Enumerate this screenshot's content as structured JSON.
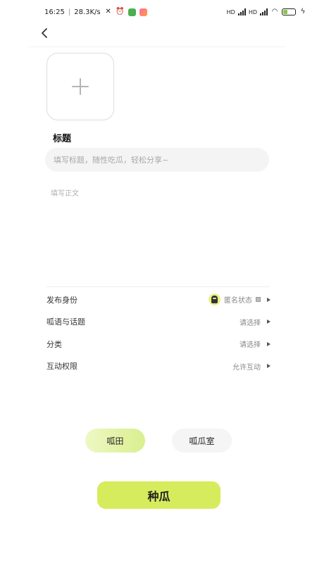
{
  "status_bar": {
    "time": "16:25",
    "separator": "|",
    "speed": "28.3K/s",
    "network_label_1": "HD",
    "network_label_2": "HD",
    "battery_level": 0.35
  },
  "header": {
    "back_icon": "chevron-left-icon"
  },
  "composer": {
    "add_image_icon": "plus-icon",
    "title_label": "标题",
    "title_placeholder": "填写标题，随性吃瓜，轻松分享~",
    "title_value": "",
    "body_placeholder": "填写正文",
    "body_value": ""
  },
  "settings": [
    {
      "label": "发布身份",
      "value": "匿名状态",
      "has_avatar": true
    },
    {
      "label": "呱语与话题",
      "value": "请选择"
    },
    {
      "label": "分类",
      "value": "请选择"
    },
    {
      "label": "互动权限",
      "value": "允许互动"
    }
  ],
  "segments": {
    "active_label": "呱田",
    "inactive_label": "呱瓜室"
  },
  "submit_label": "种瓜",
  "colors": {
    "accent": "#d6ec5c",
    "accent_light": "#eef8c4",
    "input_bg": "#f4f4f4"
  }
}
